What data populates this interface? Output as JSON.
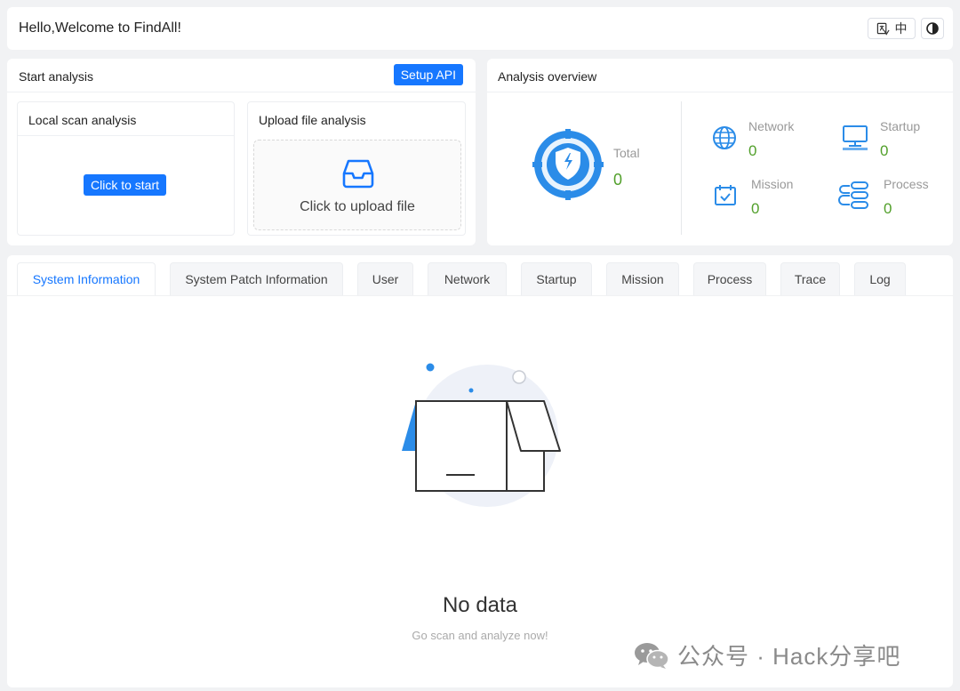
{
  "header": {
    "title": "Hello,Welcome to FindAll!",
    "lang_label": "中",
    "lang_icon": "translate-icon",
    "theme_icon": "half-circle-icon"
  },
  "start_analysis": {
    "title": "Start analysis",
    "setup_api_label": "Setup API",
    "local": {
      "title": "Local scan analysis",
      "button_label": "Click to start"
    },
    "upload": {
      "title": "Upload file analysis",
      "drop_label": "Click to upload file",
      "icon": "inbox-icon"
    }
  },
  "overview": {
    "title": "Analysis overview",
    "total": {
      "label": "Total",
      "value": "0"
    },
    "stats": [
      {
        "label": "Network",
        "value": "0",
        "icon": "globe-icon"
      },
      {
        "label": "Startup",
        "value": "0",
        "icon": "monitor-icon"
      },
      {
        "label": "Mission",
        "value": "0",
        "icon": "calendar-check-icon"
      },
      {
        "label": "Process",
        "value": "0",
        "icon": "process-flow-icon"
      }
    ]
  },
  "tabs": [
    "System Information",
    "System Patch Information",
    "User",
    "Network",
    "Startup",
    "Mission",
    "Process",
    "Trace",
    "Log"
  ],
  "active_tab": "System Information",
  "empty": {
    "title": "No data",
    "subtitle": "Go scan and analyze now!"
  },
  "watermark": {
    "text": "公众号 · Hack分享吧"
  },
  "colors": {
    "primary": "#1677ff",
    "value_green": "#52a02b",
    "page_bg": "#f1f2f4"
  }
}
